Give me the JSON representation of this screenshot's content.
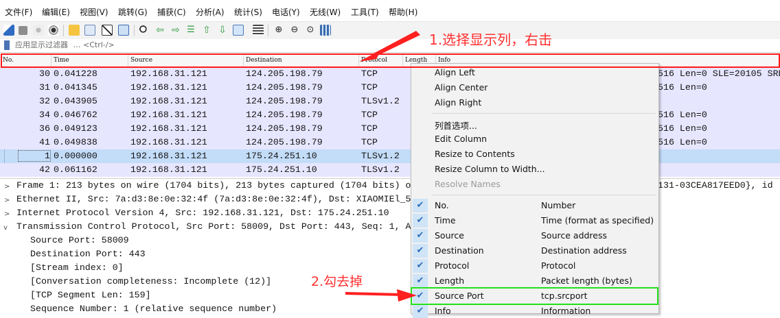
{
  "menu": [
    "文件(F)",
    "编辑(E)",
    "视图(V)",
    "跳转(G)",
    "捕获(C)",
    "分析(A)",
    "统计(S)",
    "电话(Y)",
    "无线(W)",
    "工具(T)",
    "帮助(H)"
  ],
  "filter": {
    "label": "应用显示过滤器",
    "shortcut": "… <Ctrl-/>"
  },
  "columns": {
    "no": "No.",
    "time": "Time",
    "source": "Source",
    "destination": "Destination",
    "protocol": "Protocol",
    "length": "Length",
    "info": "Info"
  },
  "packets": [
    {
      "no": "30",
      "time": "0.041228",
      "src": "192.168.31.121",
      "dst": "124.205.198.79",
      "proto": "TCP",
      "info": "516 Len=0 SLE=20105 SRE"
    },
    {
      "no": "31",
      "time": "0.041345",
      "src": "192.168.31.121",
      "dst": "124.205.198.79",
      "proto": "TCP",
      "info": "516 Len=0"
    },
    {
      "no": "32",
      "time": "0.043905",
      "src": "192.168.31.121",
      "dst": "124.205.198.79",
      "proto": "TLSv1.2",
      "info": ""
    },
    {
      "no": "34",
      "time": "0.046762",
      "src": "192.168.31.121",
      "dst": "124.205.198.79",
      "proto": "TCP",
      "info": "516 Len=0"
    },
    {
      "no": "36",
      "time": "0.049123",
      "src": "192.168.31.121",
      "dst": "124.205.198.79",
      "proto": "TCP",
      "info": "516 Len=0"
    },
    {
      "no": "41",
      "time": "0.049838",
      "src": "192.168.31.121",
      "dst": "124.205.198.79",
      "proto": "TCP",
      "info": "516 Len=0"
    },
    {
      "no": "1",
      "time": "0.000000",
      "src": "192.168.31.121",
      "dst": "175.24.251.10",
      "proto": "TLSv1.2",
      "info": ""
    },
    {
      "no": "42",
      "time": "0.061162",
      "src": "192.168.31.121",
      "dst": "175.24.251.10",
      "proto": "TLSv1.2",
      "info": ""
    }
  ],
  "tree": [
    {
      "text": "Frame 1: 213 bytes on wire (1704 bits), 213 bytes captured (1704 bits) o",
      "right": "131-03CEA817EED0}, id"
    },
    {
      "text": "Ethernet II, Src: 7a:d3:8e:0e:32:4f (7a:d3:8e:0e:32:4f), Dst: XIAOMIEl_5",
      "right": ""
    },
    {
      "text": "Internet Protocol Version 4, Src: 192.168.31.121, Dst: 175.24.251.10",
      "right": ""
    },
    {
      "text": "Transmission Control Protocol, Src Port: 58009, Dst Port: 443, Seq: 1, A",
      "right": ""
    }
  ],
  "tree_children": [
    "Source Port: 58009",
    "Destination Port: 443",
    "[Stream index: 0]",
    "[Conversation completeness: Incomplete (12)]",
    "[TCP Segment Len: 159]",
    "Sequence Number: 1    (relative sequence number)"
  ],
  "context_menu": {
    "align": [
      "Align Left",
      "Align Center",
      "Align Right"
    ],
    "actions": [
      "列首选项...",
      "Edit Column",
      "Resize to Contents",
      "Resize Column to Width...",
      "Resolve Names"
    ],
    "columns": [
      {
        "name": "No.",
        "desc": "Number",
        "checked": true
      },
      {
        "name": "Time",
        "desc": "Time (format as specified)",
        "checked": true
      },
      {
        "name": "Source",
        "desc": "Source address",
        "checked": true
      },
      {
        "name": "Destination",
        "desc": "Destination address",
        "checked": true
      },
      {
        "name": "Protocol",
        "desc": "Protocol",
        "checked": true
      },
      {
        "name": "Length",
        "desc": "Packet length (bytes)",
        "checked": true
      },
      {
        "name": "Source Port",
        "desc": "tcp.srcport",
        "checked": true
      },
      {
        "name": "Info",
        "desc": "Information",
        "checked": true
      }
    ]
  },
  "annotations": {
    "step1": "1.选择显示列，右击",
    "step2": "2.勾去掉"
  },
  "colors": {
    "tcp_row": "#e7e6ff",
    "selected_row": "#c3dcf8",
    "annotation": "#ff3030",
    "highlight_green": "#22e01a",
    "check_bg": "#cfe4f7"
  }
}
